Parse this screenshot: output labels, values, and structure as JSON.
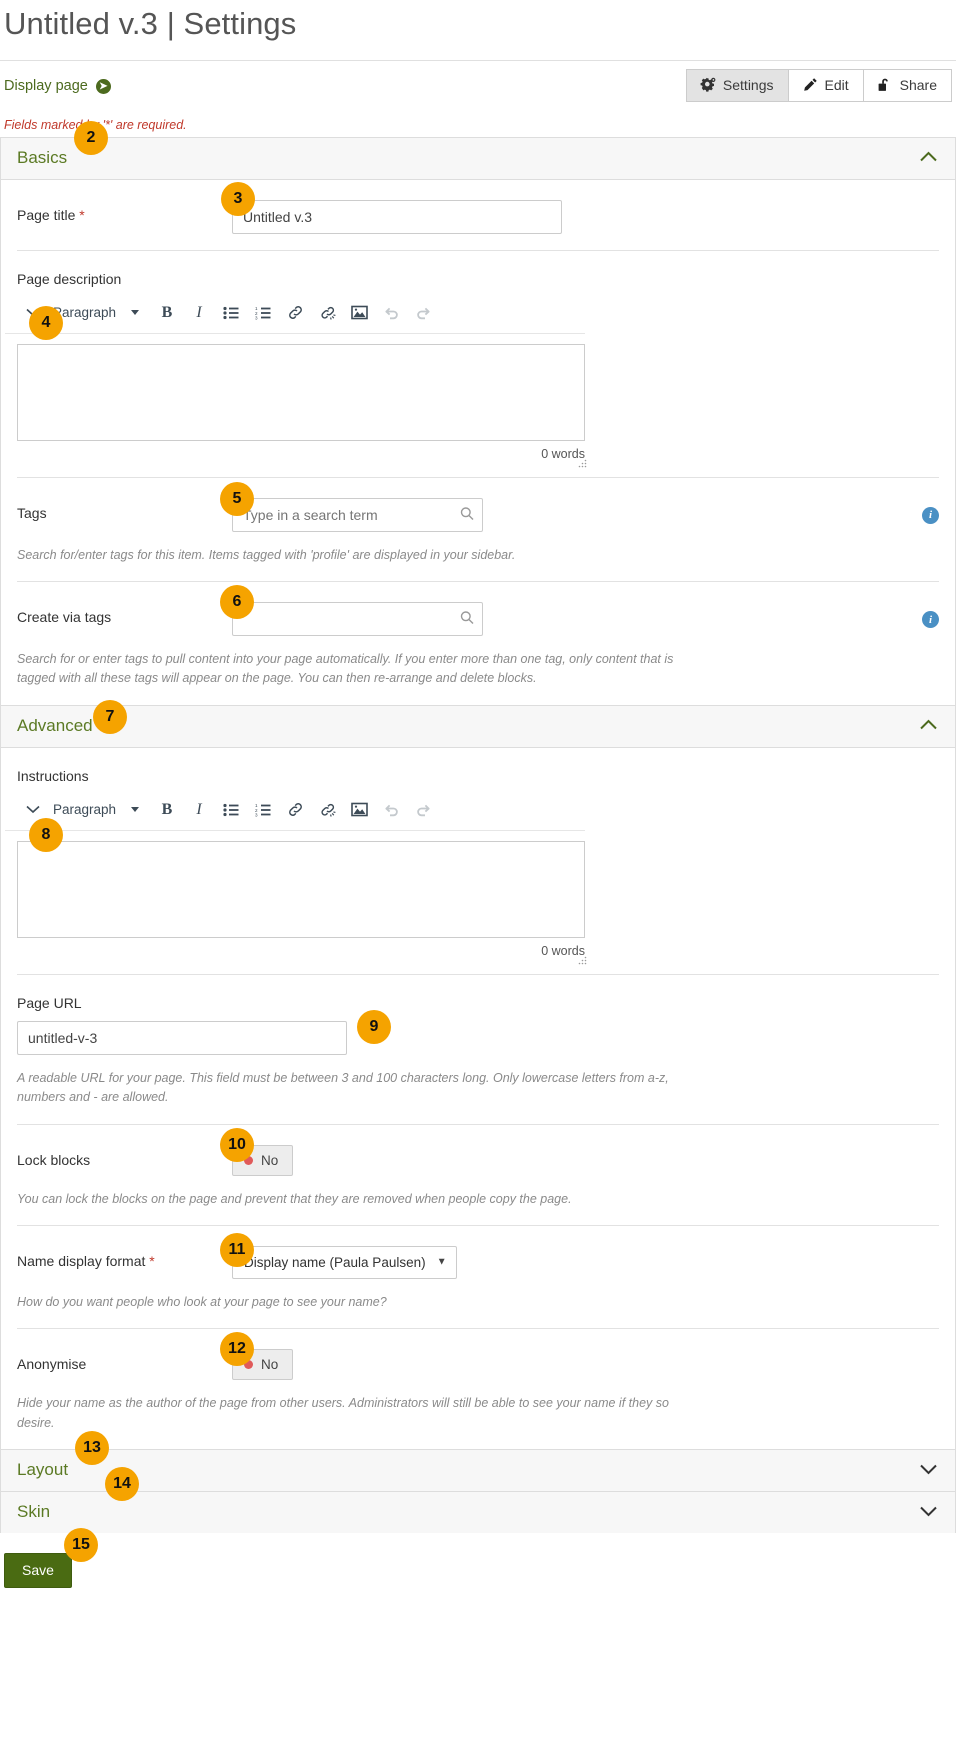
{
  "header": {
    "title": "Untitled v.3 | Settings",
    "display_page_link": "Display page",
    "buttons": [
      {
        "label": "Settings",
        "icon": "gear-icon",
        "active": true
      },
      {
        "label": "Edit",
        "icon": "pencil-icon",
        "active": false
      },
      {
        "label": "Share",
        "icon": "unlock-icon",
        "active": false
      }
    ]
  },
  "required_note": "Fields marked by '*' are required.",
  "sections": {
    "basics": {
      "legend": "Basics",
      "expanded": true
    },
    "advanced": {
      "legend": "Advanced",
      "expanded": true
    },
    "layout": {
      "legend": "Layout",
      "expanded": false
    },
    "skin": {
      "legend": "Skin",
      "expanded": false
    }
  },
  "fields": {
    "page_title": {
      "label": "Page title",
      "required_marker": "*",
      "value": "Untitled v.3"
    },
    "page_description": {
      "label": "Page description",
      "word_count": "0 words",
      "format_value": "Paragraph"
    },
    "tags": {
      "label": "Tags",
      "placeholder": "Type in a search term",
      "value": "",
      "help": "Search for/enter tags for this item. Items tagged with 'profile' are displayed in your sidebar."
    },
    "create_via_tags": {
      "label": "Create via tags",
      "placeholder": "",
      "value": "",
      "help": "Search for or enter tags to pull content into your page automatically. If you enter more than one tag, only content that is tagged with all these tags will appear on the page. You can then re-arrange and delete blocks."
    },
    "instructions": {
      "label": "Instructions",
      "word_count": "0 words",
      "format_value": "Paragraph"
    },
    "page_url": {
      "label": "Page URL",
      "value": "untitled-v-3",
      "help": "A readable URL for your page. This field must be between 3 and 100 characters long. Only lowercase letters from a-z, numbers and - are allowed."
    },
    "lock_blocks": {
      "label": "Lock blocks",
      "toggle_value": "No",
      "help": "You can lock the blocks on the page and prevent that they are removed when people copy the page."
    },
    "name_display_format": {
      "label": "Name display format",
      "required_marker": "*",
      "selected": "Display name (Paula Paulsen)",
      "help": "How do you want people who look at your page to see your name?"
    },
    "anonymise": {
      "label": "Anonymise",
      "toggle_value": "No",
      "help": "Hide your name as the author of the page from other users. Administrators will still be able to see your name if they so desire."
    }
  },
  "toolbar_icons": [
    "chevron-down-icon",
    "format-select",
    "bold-icon",
    "italic-icon",
    "bullet-list-icon",
    "numbered-list-icon",
    "link-icon",
    "unlink-icon",
    "image-icon",
    "undo-icon",
    "redo-icon"
  ],
  "save": {
    "label": "Save"
  },
  "callouts": [
    {
      "n": "2"
    },
    {
      "n": "3"
    },
    {
      "n": "4"
    },
    {
      "n": "5"
    },
    {
      "n": "6"
    },
    {
      "n": "7"
    },
    {
      "n": "8"
    },
    {
      "n": "9"
    },
    {
      "n": "10"
    },
    {
      "n": "11"
    },
    {
      "n": "12"
    },
    {
      "n": "13"
    },
    {
      "n": "14"
    },
    {
      "n": "15"
    }
  ],
  "colors": {
    "accent_green": "#4c6a1e",
    "badge_orange": "#f5a300",
    "required_red": "#c0392b",
    "save_green": "#4a6b12"
  }
}
